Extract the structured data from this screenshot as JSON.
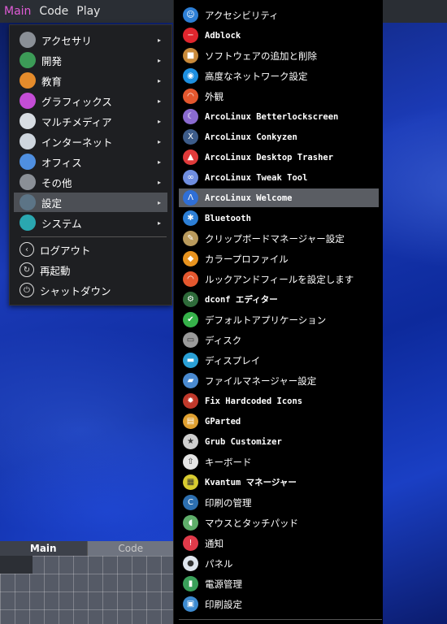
{
  "topbar": {
    "items": [
      "Main",
      "Code",
      "Play"
    ]
  },
  "bottom_panel": {
    "tabs": [
      "Main",
      "Code"
    ]
  },
  "main_menu": {
    "items": [
      {
        "label": "アクセサリ",
        "icon": "accessories-gear-icon",
        "color": "#8a8f96",
        "arrow": true
      },
      {
        "label": "開発",
        "icon": "development-chip-icon",
        "color": "#3c9b57",
        "arrow": true
      },
      {
        "label": "教育",
        "icon": "education-atom-icon",
        "color": "#e58b2b",
        "arrow": true
      },
      {
        "label": "グラフィックス",
        "icon": "graphics-palette-icon",
        "color": "#c44dd6",
        "arrow": true
      },
      {
        "label": "マルチメディア",
        "icon": "multimedia-speaker-icon",
        "color": "#d8dde3",
        "arrow": true
      },
      {
        "label": "インターネット",
        "icon": "internet-network-icon",
        "color": "#cfd6de",
        "arrow": true
      },
      {
        "label": "オフィス",
        "icon": "office-document-icon",
        "color": "#4f8fe0",
        "arrow": true
      },
      {
        "label": "その他",
        "icon": "other-gear-icon",
        "color": "#8a8f96",
        "arrow": true
      },
      {
        "label": "設定",
        "icon": "settings-panel-icon",
        "color": "#5c7486",
        "arrow": true
      },
      {
        "label": "システム",
        "icon": "system-search-icon",
        "color": "#2aa7b0",
        "arrow": true
      }
    ],
    "session": [
      {
        "label": "ログアウト",
        "icon": "logout-icon",
        "glyph": "‹"
      },
      {
        "label": "再起動",
        "icon": "restart-icon",
        "glyph": "↻"
      },
      {
        "label": "シャットダウン",
        "icon": "shutdown-icon",
        "glyph": "⏻"
      }
    ],
    "arrow_glyph": "▸"
  },
  "settings_menu": {
    "items": [
      {
        "label": "アクセシビリティ",
        "icon": "accessibility-icon",
        "color": "#2d7fd6",
        "glyph": "☺",
        "mono": false
      },
      {
        "label": "Adblock",
        "icon": "adblock-icon",
        "color": "#e0262e",
        "glyph": "−",
        "mono": true
      },
      {
        "label": "ソフトウェアの追加と削除",
        "icon": "software-box-icon",
        "color": "#c98a3a",
        "glyph": "■",
        "mono": false
      },
      {
        "label": "高度なネットワーク設定",
        "icon": "network-globe-icon",
        "color": "#1d8fe0",
        "glyph": "◉",
        "mono": false
      },
      {
        "label": "外観",
        "icon": "appearance-rainbow-icon",
        "color": "#e4572e",
        "glyph": "◠",
        "mono": false
      },
      {
        "label": "ArcoLinux Betterlockscreen",
        "icon": "lockscreen-icon",
        "color": "#8a6ad0",
        "glyph": "☾",
        "mono": true
      },
      {
        "label": "ArcoLinux Conkyzen",
        "icon": "conky-icon",
        "color": "#3d5c8a",
        "glyph": "X",
        "mono": true
      },
      {
        "label": "ArcoLinux Desktop Trasher",
        "icon": "trasher-icon",
        "color": "#e03a3a",
        "glyph": "▲",
        "mono": true
      },
      {
        "label": "ArcoLinux Tweak Tool",
        "icon": "tweak-tool-icon",
        "color": "#6f8ee0",
        "glyph": "∞",
        "mono": true
      },
      {
        "label": "ArcoLinux Welcome",
        "icon": "welcome-arco-icon",
        "color": "#2f6fd6",
        "glyph": "Λ",
        "mono": true
      },
      {
        "label": "Bluetooth",
        "icon": "bluetooth-icon",
        "color": "#2d7fd6",
        "glyph": "✱",
        "mono": true
      },
      {
        "label": "クリップボードマネージャー設定",
        "icon": "clipboard-icon",
        "color": "#b99a5c",
        "glyph": "✎",
        "mono": false
      },
      {
        "label": "カラープロファイル",
        "icon": "color-profile-icon",
        "color": "#e8931e",
        "glyph": "◆",
        "mono": false
      },
      {
        "label": "ルックアンドフィールを設定します",
        "icon": "look-and-feel-icon",
        "color": "#e4572e",
        "glyph": "◠",
        "mono": false
      },
      {
        "label": "dconf エディター",
        "icon": "dconf-icon",
        "color": "#2e6b3a",
        "glyph": "⚙",
        "mono": true
      },
      {
        "label": "デフォルトアプリケーション",
        "icon": "default-apps-check-icon",
        "color": "#36b24a",
        "glyph": "✔",
        "mono": false
      },
      {
        "label": "ディスク",
        "icon": "disk-icon",
        "color": "#9a9a9a",
        "glyph": "▭",
        "mono": false
      },
      {
        "label": "ディスプレイ",
        "icon": "display-icon",
        "color": "#2aa0d6",
        "glyph": "▬",
        "mono": false
      },
      {
        "label": "ファイルマネージャー設定",
        "icon": "file-manager-folder-icon",
        "color": "#4a8ad0",
        "glyph": "▰",
        "mono": false
      },
      {
        "label": "Fix Hardcoded Icons",
        "icon": "fix-icons-bug-icon",
        "color": "#c0392b",
        "glyph": "✹",
        "mono": true
      },
      {
        "label": "GParted",
        "icon": "gparted-icon",
        "color": "#e0a030",
        "glyph": "▤",
        "mono": true
      },
      {
        "label": "Grub Customizer",
        "icon": "grub-customizer-icon",
        "color": "#cfcfcf",
        "glyph": "★",
        "mono": true
      },
      {
        "label": "キーボード",
        "icon": "keyboard-icon",
        "color": "#e6e6e6",
        "glyph": "⇧",
        "mono": false
      },
      {
        "label": "Kvantum マネージャー",
        "icon": "kvantum-icon",
        "color": "#d8cc30",
        "glyph": "▦",
        "mono": true
      },
      {
        "label": "印刷の管理",
        "icon": "print-manage-icon",
        "color": "#2d6fb0",
        "glyph": "C",
        "mono": false
      },
      {
        "label": "マウスとタッチパッド",
        "icon": "mouse-icon",
        "color": "#5fae6a",
        "glyph": "◖",
        "mono": false
      },
      {
        "label": "通知",
        "icon": "notification-icon",
        "color": "#e03a4a",
        "glyph": "!",
        "mono": false
      },
      {
        "label": "パネル",
        "icon": "panel-icon",
        "color": "#dfe6ee",
        "glyph": "●",
        "mono": false
      },
      {
        "label": "電源管理",
        "icon": "power-battery-icon",
        "color": "#3aa05a",
        "glyph": "▮",
        "mono": false
      },
      {
        "label": "印刷設定",
        "icon": "printer-icon",
        "color": "#3d8ad0",
        "glyph": "▣",
        "mono": false
      }
    ],
    "highlighted_index": 9
  }
}
